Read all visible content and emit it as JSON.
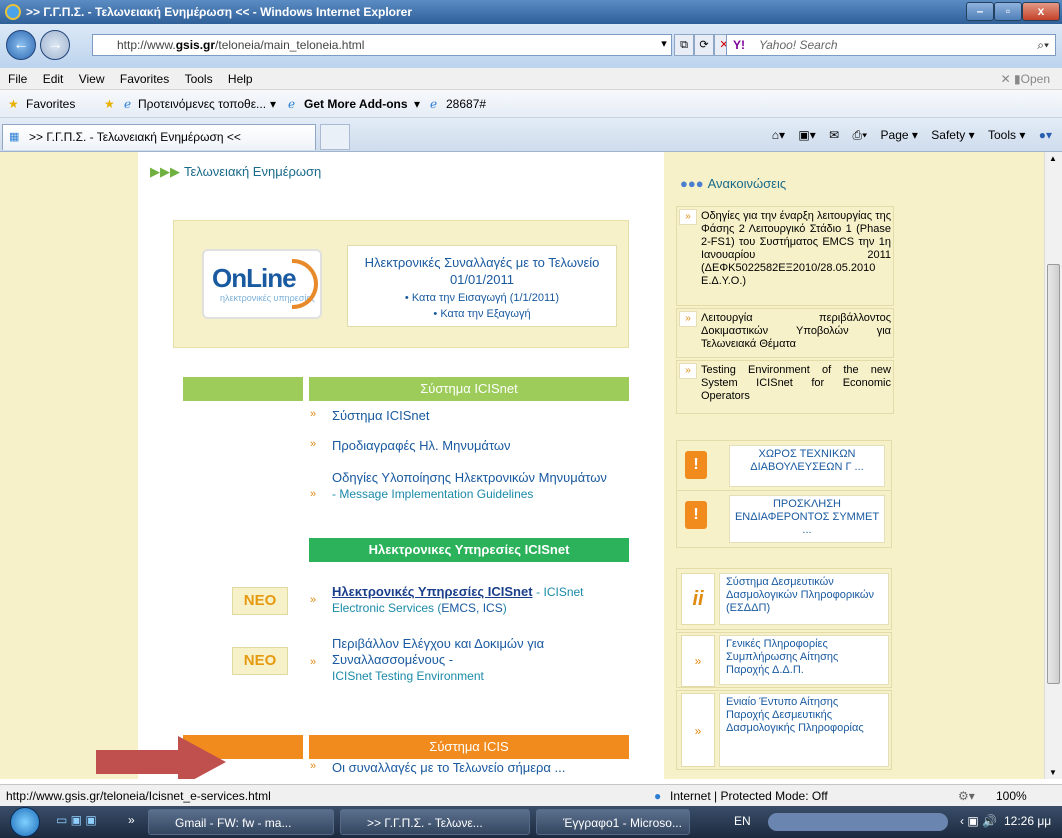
{
  "window": {
    "title": ">> Γ.Γ.Π.Σ. - Τελωνειακή Ενημέρωση << - Windows Internet Explorer"
  },
  "address": {
    "url_prefix": "http://www.",
    "url_domain": "gsis.gr",
    "url_path": "/teloneia/main_teloneia.html",
    "search_placeholder": "Yahoo! Search"
  },
  "menu": [
    "File",
    "Edit",
    "View",
    "Favorites",
    "Tools",
    "Help"
  ],
  "favorites": {
    "label": "Favorites",
    "suggested": "Προτεινόμενες τοποθε...",
    "addons": "Get More Add-ons",
    "code": "28687#"
  },
  "tab": {
    "title": ">> Γ.Γ.Π.Σ. - Τελωνειακή Ενημέρωση <<"
  },
  "commands": {
    "page": "Page ▾",
    "safety": "Safety ▾",
    "tools": "Tools ▾"
  },
  "content": {
    "header": "Τελωνειακή Ενημέρωση",
    "online": {
      "logo_main": "OnLine",
      "logo_sub": "ηλεκτρονικές υπηρεσίες",
      "title": "Ηλεκτρονικές Συναλλαγές με το Τελωνείο 01/01/2011",
      "import": "Κατα την Εισαγωγή (1/1/2011)",
      "export": "Κατα την Εξαγωγή"
    },
    "icisnet_band": "Σύστημα ICISnet",
    "links1": [
      "Σύστημα ICISnet",
      "Προδιαγραφές Ηλ. Μηνυμάτων"
    ],
    "guidelines_gr": "Οδηγίες Υλοποίησης Ηλεκτρονικών Μηνυμάτων",
    "guidelines_en": "- Message Implementation Guidelines",
    "eservices_band": "Ηλεκτρονικες Υπηρεσίες ICISnet",
    "neo": "NEO",
    "eservices_gr": "Ηλεκτρονικές Υπηρεσίες ICISnet",
    "eservices_en1": "- ICISnet",
    "eservices_en2": "Electronic Services (",
    "eservices_en3": "EMCS, ICS",
    "eservices_en4": ")",
    "testing_gr": "Περιβάλλον Ελέγχου και Δοκιμών για Συναλλασσομένους",
    "testing_en1": " -",
    "testing_en2": "ICISnet Testing Environment",
    "icis_band": "Σύστημα ICIS",
    "icis_link": "Οι συναλλαγές με το Τελωνείο σήμερα ..."
  },
  "sidebar": {
    "header": "Ανακοινώσεις",
    "ann": [
      "Οδηγίες για την έναρξη λειτουργίας της Φάσης 2 Λειτουργικό Στάδιο 1 (Phase 2-FS1) του Συστήματος EMCS την 1η Ιανουαρίου 2011 (ΔΕΦΚ5022582ΕΞ2010/28.05.2010 Ε.Δ.Υ.Ο.)",
      "Λειτουργία περιβάλλοντος Δοκιμαστικών Υποβολών για Τελωνειακά Θέματα",
      "Testing Environment of the new System ICISnet for Economic Operators"
    ],
    "box1": "ΧΩΡΟΣ ΤΕΧΝΙΚΩΝ ΔΙΑΒΟΥΛΕΥΣΕΩΝ Γ ...",
    "box2": "ΠΡΟΣΚΛΗΣΗ ΕΝΔΙΑΦΕΡΟΝΤΟΣ ΣΥΜΜΕΤ ...",
    "esdp1": "Σύστημα Δεσμευτικών Δασμολογικών Πληροφορικών (ΕΣΔΔΠ)",
    "esdp2": "Γενικές Πληροφορίες Συμπλήρωσης Αίτησης Παροχής Δ.Δ.Π.",
    "esdp3": "Ενιαίο Έντυπο Αίτησης Παροχής Δεσμευτικής Δασμολογικής Πληροφορίας"
  },
  "status": {
    "url": "http://www.gsis.gr/teloneia/Icisnet_e-services.html",
    "zone": "Internet | Protected Mode: Off",
    "zoom": "100%"
  },
  "taskbar": {
    "gmail": "Gmail - FW: fw - ma...",
    "ie": ">> Γ.Γ.Π.Σ. - Τελωνε...",
    "word": "Έγγραφο1 - Microso...",
    "lang": "EN",
    "time": "12:26 μμ"
  }
}
